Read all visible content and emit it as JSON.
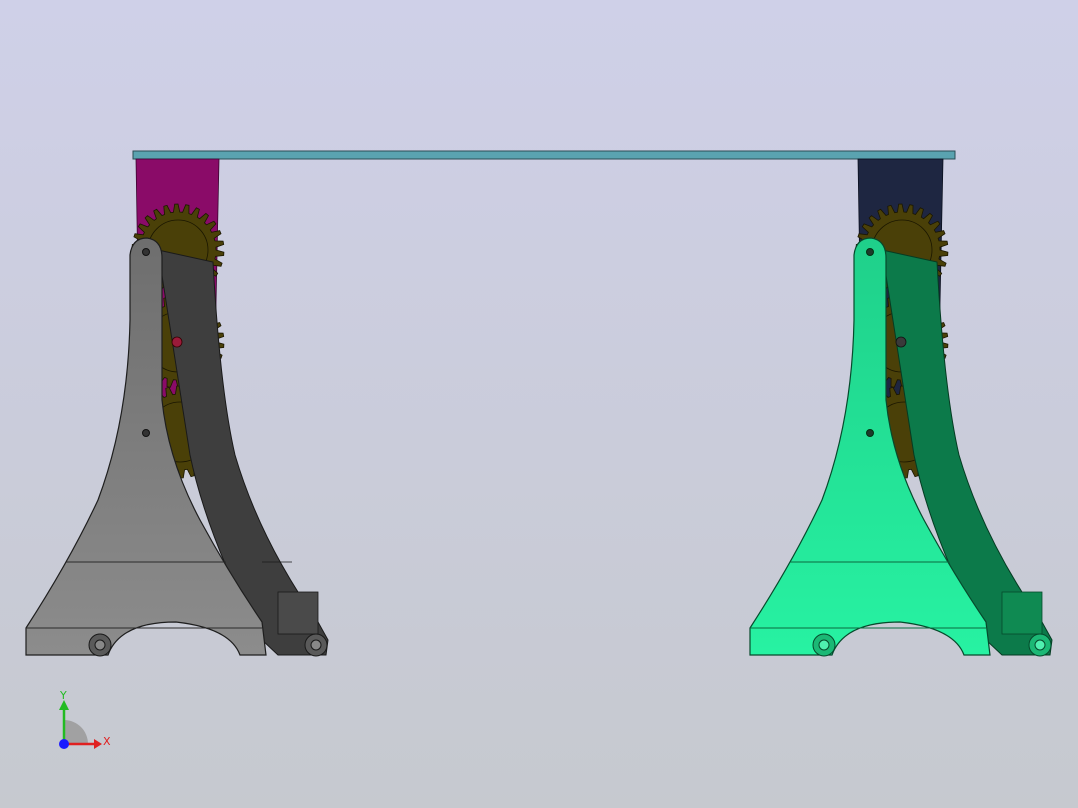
{
  "viewport": {
    "background_top": "#cfd0e8",
    "background_bottom": "#c6c9cf"
  },
  "model": {
    "crossbar_color": "#5aa3b0",
    "left_support": {
      "body_color": "#777777",
      "body_dark": "#3e3e3e",
      "bracket_color": "#8a0b68",
      "hole_color": "#9b1b3a"
    },
    "right_support": {
      "body_color": "#22e59a",
      "body_dark": "#0c7a4a",
      "bracket_color": "#1e2641",
      "hole_color": "#3a3a3a"
    },
    "gear_color": "#4a4008",
    "gear_count_per_support": 3
  },
  "triad": {
    "x_label": "X",
    "y_label": "Y",
    "x_color": "#e02020",
    "y_color": "#22bb22",
    "z_color": "#1a1aff"
  }
}
